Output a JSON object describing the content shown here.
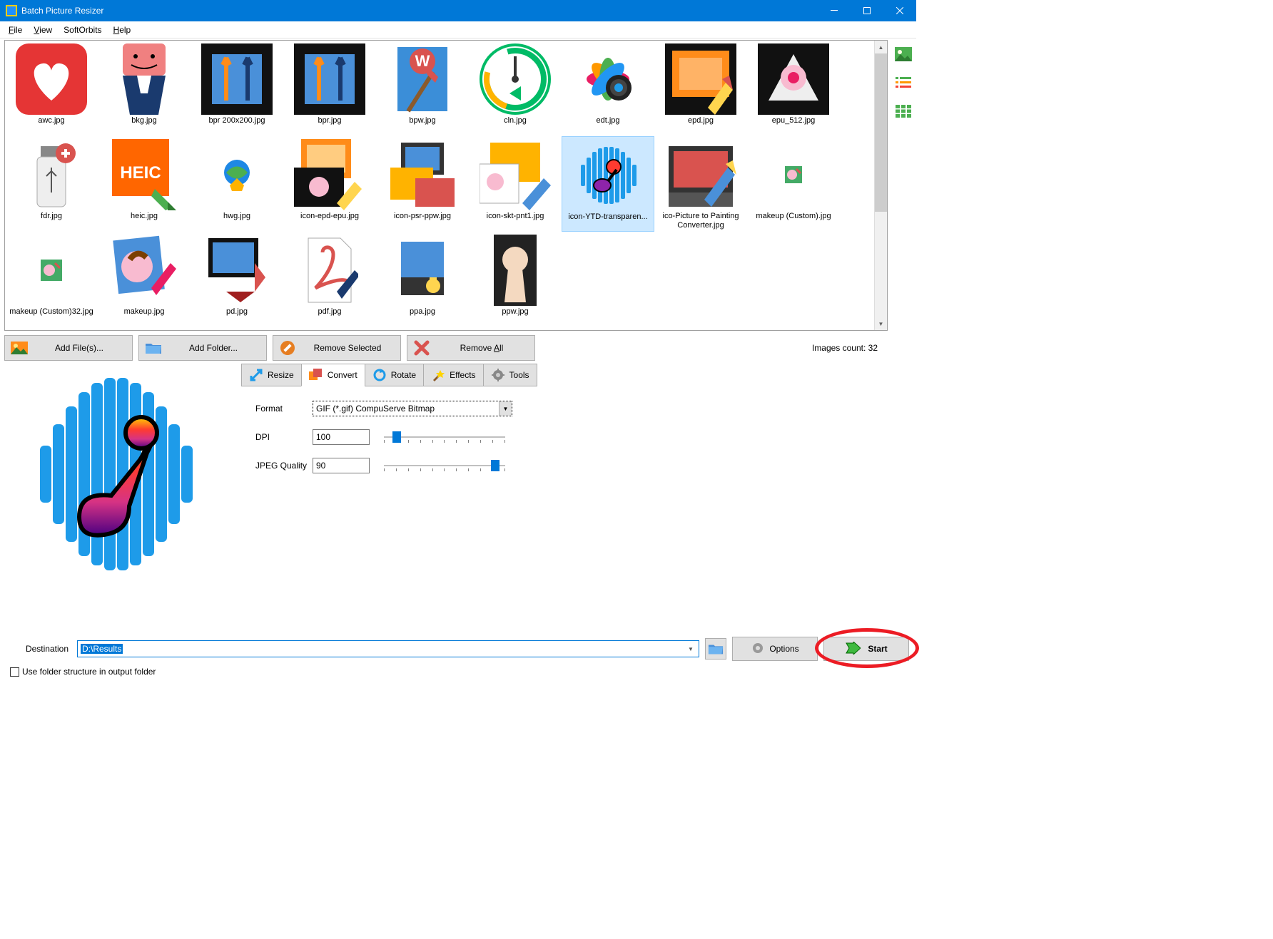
{
  "window": {
    "title": "Batch Picture Resizer"
  },
  "menu": {
    "file": "File",
    "view": "View",
    "softorbits": "SoftOrbits",
    "help": "Help"
  },
  "thumbs": [
    {
      "label": "awc.jpg"
    },
    {
      "label": "bkg.jpg"
    },
    {
      "label": "bpr 200x200.jpg"
    },
    {
      "label": "bpr.jpg"
    },
    {
      "label": "bpw.jpg"
    },
    {
      "label": "cln.jpg"
    },
    {
      "label": "edt.jpg"
    },
    {
      "label": "epd.jpg"
    },
    {
      "label": "epu_512.jpg"
    },
    {
      "label": "fdr.jpg"
    },
    {
      "label": "heic.jpg"
    },
    {
      "label": "hwg.jpg"
    },
    {
      "label": "icon-epd-epu.jpg"
    },
    {
      "label": "icon-psr-ppw.jpg"
    },
    {
      "label": "icon-skt-pnt1.jpg"
    },
    {
      "label": "icon-YTD-transparen..."
    },
    {
      "label": "ico-Picture to Painting Converter.jpg"
    },
    {
      "label": "makeup (Custom).jpg"
    },
    {
      "label": "makeup (Custom)32.jpg"
    },
    {
      "label": "makeup.jpg"
    },
    {
      "label": "pd.jpg"
    },
    {
      "label": "pdf.jpg"
    },
    {
      "label": "ppa.jpg"
    },
    {
      "label": "ppw.jpg"
    }
  ],
  "actions": {
    "add_files": "Add File(s)...",
    "add_folder": "Add Folder...",
    "remove_selected": "Remove Selected",
    "remove_all": "Remove All"
  },
  "images_count_label": "Images count: 32",
  "tabs": {
    "resize": "Resize",
    "convert": "Convert",
    "rotate": "Rotate",
    "effects": "Effects",
    "tools": "Tools"
  },
  "convert": {
    "format_label": "Format",
    "format_value": "GIF (*.gif) CompuServe Bitmap",
    "dpi_label": "DPI",
    "dpi_value": "100",
    "jpeg_label": "JPEG Quality",
    "jpeg_value": "90"
  },
  "destination": {
    "label": "Destination",
    "value": "D:\\Results"
  },
  "options_label": "Options",
  "start_label": "Start",
  "use_folder_structure": "Use folder structure in output folder",
  "side_view_labels": {
    "thumbs": "thumbnails",
    "list": "list",
    "details": "details"
  }
}
